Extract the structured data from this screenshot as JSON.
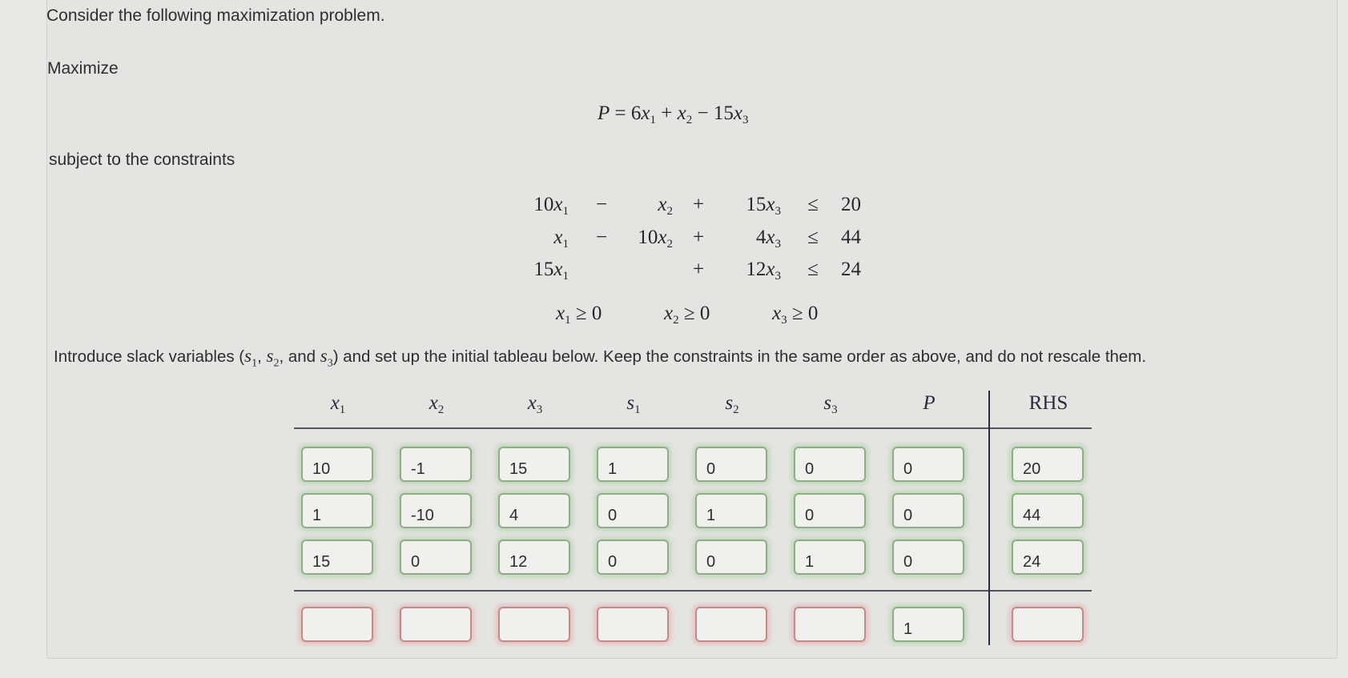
{
  "question": {
    "intro": "Consider the following maximization problem.",
    "maximize_label": "Maximize",
    "objective": {
      "lhs": "P",
      "eq": "=",
      "terms": [
        "6",
        "x",
        "1",
        "+",
        "x",
        "2",
        "−",
        "15",
        "x",
        "3"
      ]
    },
    "subject_label": "subject to the constraints",
    "constraints": [
      {
        "c1": "10",
        "op1": "−",
        "c2": "",
        "op2": "+",
        "c3": "15",
        "rel": "≤",
        "rhs": "20"
      },
      {
        "c1": "",
        "op1": "−",
        "c2": "10",
        "op2": "+",
        "c3": "4",
        "rel": "≤",
        "rhs": "44"
      },
      {
        "c1": "15",
        "op1": "",
        "c2": null,
        "op2": "+",
        "c3": "12",
        "rel": "≤",
        "rhs": "24"
      }
    ],
    "nonnegativity": [
      {
        "var": "x",
        "sub": "1",
        "rel": "≥",
        "val": "0"
      },
      {
        "var": "x",
        "sub": "2",
        "rel": "≥",
        "val": "0"
      },
      {
        "var": "x",
        "sub": "3",
        "rel": "≥",
        "val": "0"
      }
    ],
    "instruction_part1": "Introduce slack variables (",
    "instruction_vars": [
      {
        "v": "s",
        "sub": "1",
        "after": ", "
      },
      {
        "v": "s",
        "sub": "2",
        "after": ", and "
      },
      {
        "v": "s",
        "sub": "3",
        "after": ""
      }
    ],
    "instruction_part2": ") and set up the initial tableau below. Keep the constraints in the same order as above, and do not rescale them."
  },
  "tableau": {
    "headers": [
      {
        "v": "x",
        "sub": "1"
      },
      {
        "v": "x",
        "sub": "2"
      },
      {
        "v": "x",
        "sub": "3"
      },
      {
        "v": "s",
        "sub": "1"
      },
      {
        "v": "s",
        "sub": "2"
      },
      {
        "v": "s",
        "sub": "3"
      },
      {
        "v": "P",
        "sub": ""
      },
      {
        "v": "RHS",
        "sub": ""
      }
    ],
    "rows": [
      {
        "values": [
          "10",
          "-1",
          "15",
          "1",
          "0",
          "0",
          "0",
          "20"
        ],
        "status": [
          "ok",
          "ok",
          "ok",
          "ok",
          "ok",
          "ok",
          "ok",
          "ok"
        ]
      },
      {
        "values": [
          "1",
          "-10",
          "4",
          "0",
          "1",
          "0",
          "0",
          "44"
        ],
        "status": [
          "ok",
          "ok",
          "ok",
          "ok",
          "ok",
          "ok",
          "ok",
          "ok"
        ]
      },
      {
        "values": [
          "15",
          "0",
          "12",
          "0",
          "0",
          "1",
          "0",
          "24"
        ],
        "status": [
          "ok",
          "ok",
          "ok",
          "ok",
          "ok",
          "ok",
          "ok",
          "ok"
        ]
      },
      {
        "values": [
          "",
          "",
          "",
          "",
          "",
          "",
          "1",
          ""
        ],
        "status": [
          "bad",
          "bad",
          "bad",
          "bad",
          "bad",
          "bad",
          "ok",
          "bad"
        ]
      }
    ],
    "colors": {
      "correct_border": "#8fae88",
      "incorrect_border": "#c48a8a"
    }
  }
}
